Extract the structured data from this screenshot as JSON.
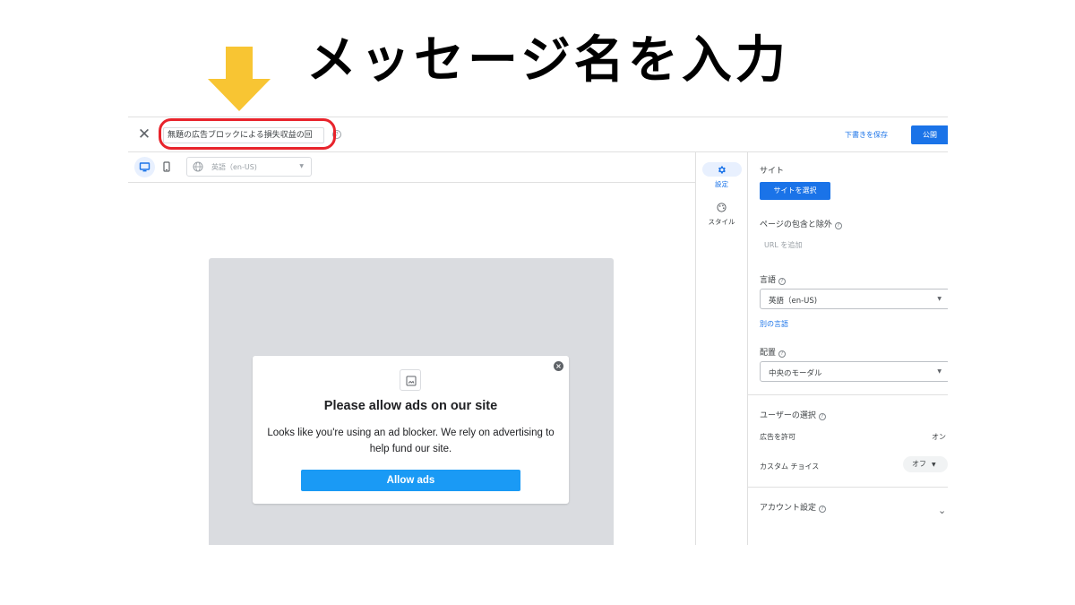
{
  "annotation": {
    "title": "メッセージ名を入力",
    "arrow_color": "#f8c533",
    "highlight_color": "#e8242c"
  },
  "topbar": {
    "close_icon": "close-icon",
    "message_name": "無題の広告ブロックによる損失収益の回",
    "save_draft": "下書きを保存",
    "publish": "公開"
  },
  "toolbar": {
    "language": "英語（en-US)"
  },
  "preview": {
    "title": "Please allow ads on our site",
    "body": "Looks like you're using an ad blocker. We rely on advertising to help fund our site.",
    "button": "Allow ads",
    "button_color": "#1a9af5"
  },
  "rail": {
    "settings": "設定",
    "style": "スタイル"
  },
  "panel": {
    "site_heading": "サイト",
    "select_site": "サイトを選択",
    "page_include_exclude": "ページの包含と除外",
    "add_url": "URL を追加",
    "language_heading": "言語",
    "language_value": "英語（en-US)",
    "other_language": "別の言語",
    "placement_heading": "配置",
    "placement_value": "中央のモーダル",
    "user_choice_heading": "ユーザーの選択",
    "allow_ads_label": "広告を許可",
    "allow_ads_value": "オン",
    "custom_choice_label": "カスタム チョイス",
    "custom_choice_value": "オフ",
    "account_settings": "アカウント設定"
  },
  "colors": {
    "primary": "#1a73e8"
  }
}
